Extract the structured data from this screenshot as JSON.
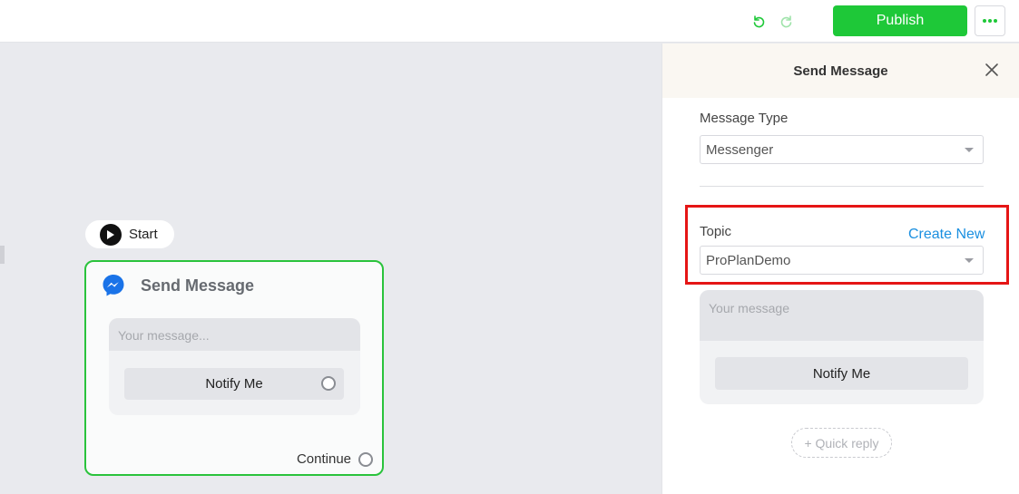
{
  "toolbar": {
    "publish_label": "Publish",
    "undo_icon": "undo-icon",
    "redo_icon": "redo-icon",
    "more_icon": "more-dots-icon",
    "accent_color": "#1ec838"
  },
  "canvas": {
    "start_label": "Start",
    "node": {
      "title": "Send Message",
      "message_placeholder": "Your message...",
      "button_label": "Notify Me",
      "continue_label": "Continue",
      "border_color": "#2ac33c"
    }
  },
  "panel": {
    "title": "Send Message",
    "message_type": {
      "label": "Message Type",
      "value": "Messenger"
    },
    "topic": {
      "label": "Topic",
      "create_new": "Create New",
      "value": "ProPlanDemo",
      "highlight_color": "#e51515"
    },
    "message": {
      "placeholder": "Your message",
      "button_label": "Notify Me"
    },
    "quick_reply_label": "+ Quick reply"
  }
}
